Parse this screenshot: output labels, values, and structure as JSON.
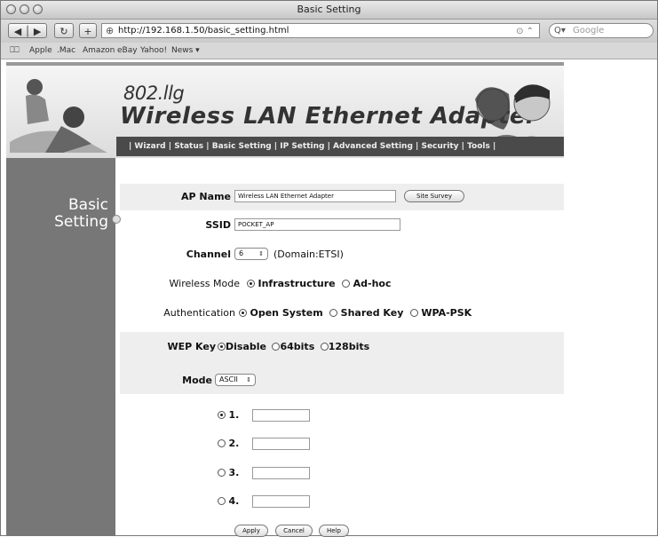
{
  "browser": {
    "title": "Basic Setting",
    "url": "http://192.168.1.50/basic_setting.html",
    "search_placeholder": "Google",
    "bookmarks": [
      "Apple",
      ".Mac",
      "Amazon",
      "eBay",
      "Yahoo!",
      "News ▾"
    ]
  },
  "banner": {
    "subtitle": "802.llg",
    "title": "Wireless LAN Ethernet Adapter",
    "nav": [
      "Wizard",
      "Status",
      "Basic Setting",
      "IP Setting",
      "Advanced Setting",
      "Security",
      "Tools"
    ]
  },
  "sidebar": {
    "title_line1": "Basic",
    "title_line2": "Setting"
  },
  "form": {
    "ap_name_label": "AP Name",
    "ap_name_value": "Wireless LAN Ethernet Adapter",
    "site_survey_button": "Site Survey",
    "ssid_label": "SSID",
    "ssid_value": "POCKET_AP",
    "channel_label": "Channel",
    "channel_value": "6",
    "domain_text": "(Domain:ETSI)",
    "wireless_mode_label": "Wireless Mode",
    "wireless_mode_options": [
      "Infrastructure",
      "Ad-hoc"
    ],
    "authentication_label": "Authentication",
    "authentication_options": [
      "Open System",
      "Shared Key",
      "WPA-PSK"
    ],
    "wep_key_label": "WEP Key",
    "wep_key_options": [
      "Disable",
      "64bits",
      "128bits"
    ],
    "mode_label": "Mode",
    "mode_value": "ASCII",
    "keys": [
      "1.",
      "2.",
      "3.",
      "4."
    ],
    "buttons": {
      "apply": "Apply",
      "cancel": "Cancel",
      "help": "Help"
    }
  }
}
